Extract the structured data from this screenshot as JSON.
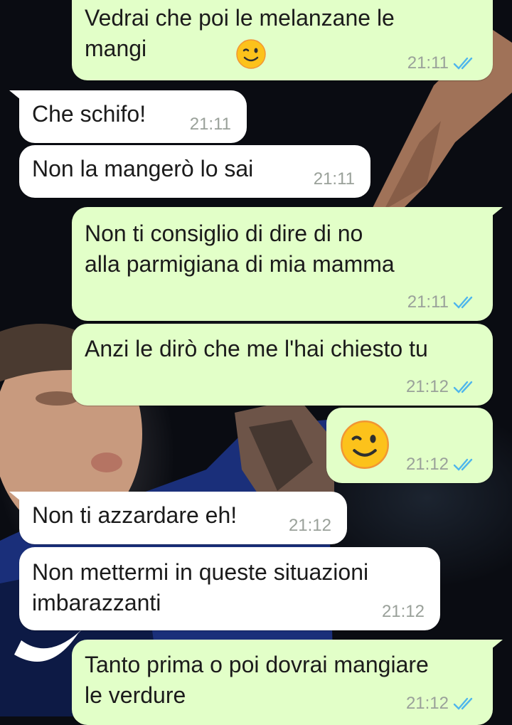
{
  "messages": [
    {
      "id": "m1",
      "direction": "out",
      "text": "Vedrai che poi le melanzane le\nmangi",
      "emoji": "wink",
      "time": "21:11",
      "status": "read"
    },
    {
      "id": "m2",
      "direction": "in",
      "text": "Che schifo!",
      "time": "21:11"
    },
    {
      "id": "m3",
      "direction": "in",
      "text": "Non la mangerò lo sai",
      "time": "21:11"
    },
    {
      "id": "m4",
      "direction": "out",
      "text": "Non ti consiglio di dire di no\nalla parmigiana di mia mamma",
      "time": "21:11",
      "status": "read"
    },
    {
      "id": "m5",
      "direction": "out",
      "text": "Anzi le dirò che me l'hai chiesto tu",
      "time": "21:12",
      "status": "read"
    },
    {
      "id": "m6",
      "direction": "out",
      "text": "",
      "emoji": "wink",
      "time": "21:12",
      "status": "read"
    },
    {
      "id": "m7",
      "direction": "in",
      "text": "Non ti azzardare eh!",
      "time": "21:12"
    },
    {
      "id": "m8",
      "direction": "in",
      "text": "Non mettermi in queste situazioni\nimbarazzanti",
      "time": "21:12"
    },
    {
      "id": "m9",
      "direction": "out",
      "text": "Tanto prima o poi dovrai mangiare\nle verdure",
      "time": "21:12",
      "status": "read"
    }
  ],
  "colors": {
    "outgoing_bubble": "#e2ffc8",
    "incoming_bubble": "#ffffff",
    "read_ticks": "#4fb6ec",
    "timestamp": "#9aa19a"
  },
  "icons": {
    "read_receipt": "double-check-icon",
    "emoji": "winking-face-emoji"
  }
}
